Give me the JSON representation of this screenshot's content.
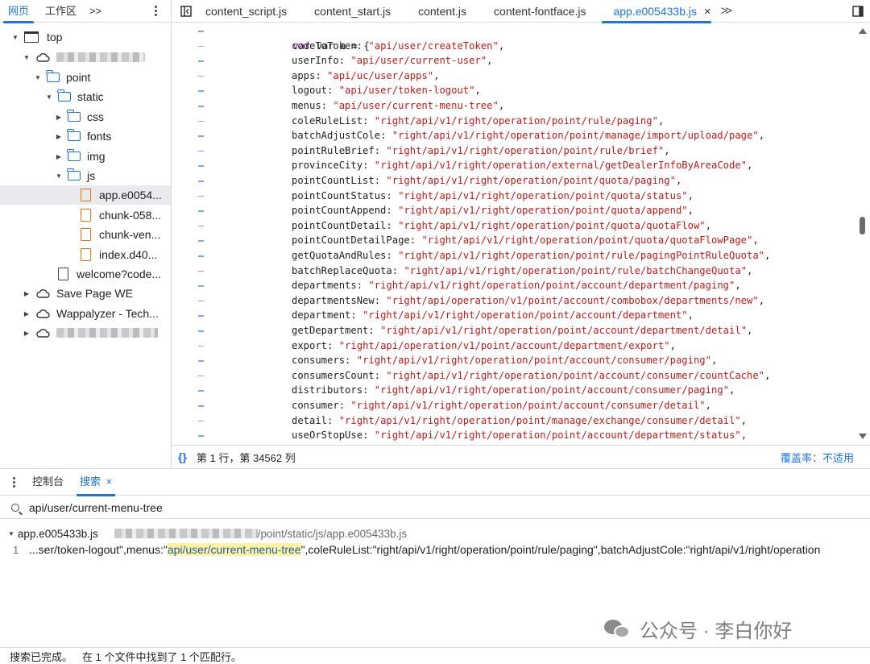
{
  "left_tabs": {
    "page": "网页",
    "workspace": "工作区",
    "more": ">>"
  },
  "file_tabs": [
    {
      "label": "content_script.js"
    },
    {
      "label": "content_start.js"
    },
    {
      "label": "content.js"
    },
    {
      "label": "content-fontface.js"
    },
    {
      "label": "app.e005433b.js",
      "active": true
    }
  ],
  "file_tabs_more": ">>",
  "tree": {
    "top": "top",
    "point": "point",
    "static": "static",
    "css": "css",
    "fonts": "fonts",
    "img": "img",
    "js": "js",
    "files": [
      "app.e0054...",
      "chunk-058...",
      "chunk-ven...",
      "index.d40..."
    ],
    "welcome": "welcome?code...",
    "save_page": "Save Page WE",
    "wappalyzer": "Wappalyzer - Tech..."
  },
  "code": {
    "header": "var a = {",
    "entries": [
      {
        "key": "codeToToken",
        "value": "\"api/user/createToken\""
      },
      {
        "key": "userInfo",
        "value": "\"api/user/current-user\""
      },
      {
        "key": "apps",
        "value": "\"api/uc/user/apps\""
      },
      {
        "key": "logout",
        "value": "\"api/user/token-logout\""
      },
      {
        "key": "menus",
        "value": "\"api/user/current-menu-tree\""
      },
      {
        "key": "coleRuleList",
        "value": "\"right/api/v1/right/operation/point/rule/paging\""
      },
      {
        "key": "batchAdjustCole",
        "value": "\"right/api/v1/right/operation/point/manage/import/upload/page\""
      },
      {
        "key": "pointRuleBrief",
        "value": "\"right/api/v1/right/operation/point/rule/brief\""
      },
      {
        "key": "provinceCity",
        "value": "\"right/api/v1/right/operation/external/getDealerInfoByAreaCode\""
      },
      {
        "key": "pointCountList",
        "value": "\"right/api/v1/right/operation/point/quota/paging\""
      },
      {
        "key": "pointCountStatus",
        "value": "\"right/api/v1/right/operation/point/quota/status\""
      },
      {
        "key": "pointCountAppend",
        "value": "\"right/api/v1/right/operation/point/quota/append\""
      },
      {
        "key": "pointCountDetail",
        "value": "\"right/api/v1/right/operation/point/quota/quotaFlow\""
      },
      {
        "key": "pointCountDetailPage",
        "value": "\"right/api/v1/right/operation/point/quota/quotaFlowPage\""
      },
      {
        "key": "getQuotaAndRules",
        "value": "\"right/api/v1/right/operation/point/rule/pagingPointRuleQuota\""
      },
      {
        "key": "batchReplaceQuota",
        "value": "\"right/api/v1/right/operation/point/rule/batchChangeQuota\""
      },
      {
        "key": "departments",
        "value": "\"right/api/v1/right/operation/point/account/department/paging\""
      },
      {
        "key": "departmentsNew",
        "value": "\"right/api/operation/v1/point/account/combobox/departments/new\""
      },
      {
        "key": "department",
        "value": "\"right/api/v1/right/operation/point/account/department\""
      },
      {
        "key": "getDepartment",
        "value": "\"right/api/v1/right/operation/point/account/department/detail\""
      },
      {
        "key": "export",
        "value": "\"right/api/operation/v1/point/account/department/export\""
      },
      {
        "key": "consumers",
        "value": "\"right/api/v1/right/operation/point/account/consumer/paging\""
      },
      {
        "key": "consumersCount",
        "value": "\"right/api/v1/right/operation/point/account/consumer/countCache\""
      },
      {
        "key": "distributors",
        "value": "\"right/api/v1/right/operation/point/account/consumer/paging\""
      },
      {
        "key": "consumer",
        "value": "\"right/api/v1/right/operation/point/account/consumer/detail\""
      },
      {
        "key": "detail",
        "value": "\"right/api/v1/right/operation/point/manage/exchange/consumer/detail\""
      },
      {
        "key": "useOrStopUse",
        "value": "\"right/api/v1/right/operation/point/account/department/status\""
      }
    ]
  },
  "status": {
    "braces": "{}",
    "position": "第 1 行，第 34562 列",
    "coverage": "覆盖率：不适用"
  },
  "drawer": {
    "console": "控制台",
    "search": "搜索",
    "close": "×"
  },
  "search": {
    "query": "api/user/current-menu-tree"
  },
  "result": {
    "file": "app.e005433b.js",
    "path": "/point/static/js/app.e005433b.js",
    "line_no": "1",
    "before": "...ser/token-logout\",menus:\"",
    "match": "api/user/current-menu-tree",
    "after": "\",coleRuleList:\"right/api/v1/right/operation/point/rule/paging\",batchAdjustCole:\"right/api/v1/right/operation"
  },
  "watermark": "公众号 · 李白你好",
  "footer": {
    "done": "搜索已完成。",
    "summary": "在 1 个文件中找到了 1 个匹配行。"
  },
  "colors": {
    "accent": "#1a73e8",
    "string": "#c41a16",
    "keyword": "#8f0e8f",
    "file_icon": "#e8710a"
  }
}
